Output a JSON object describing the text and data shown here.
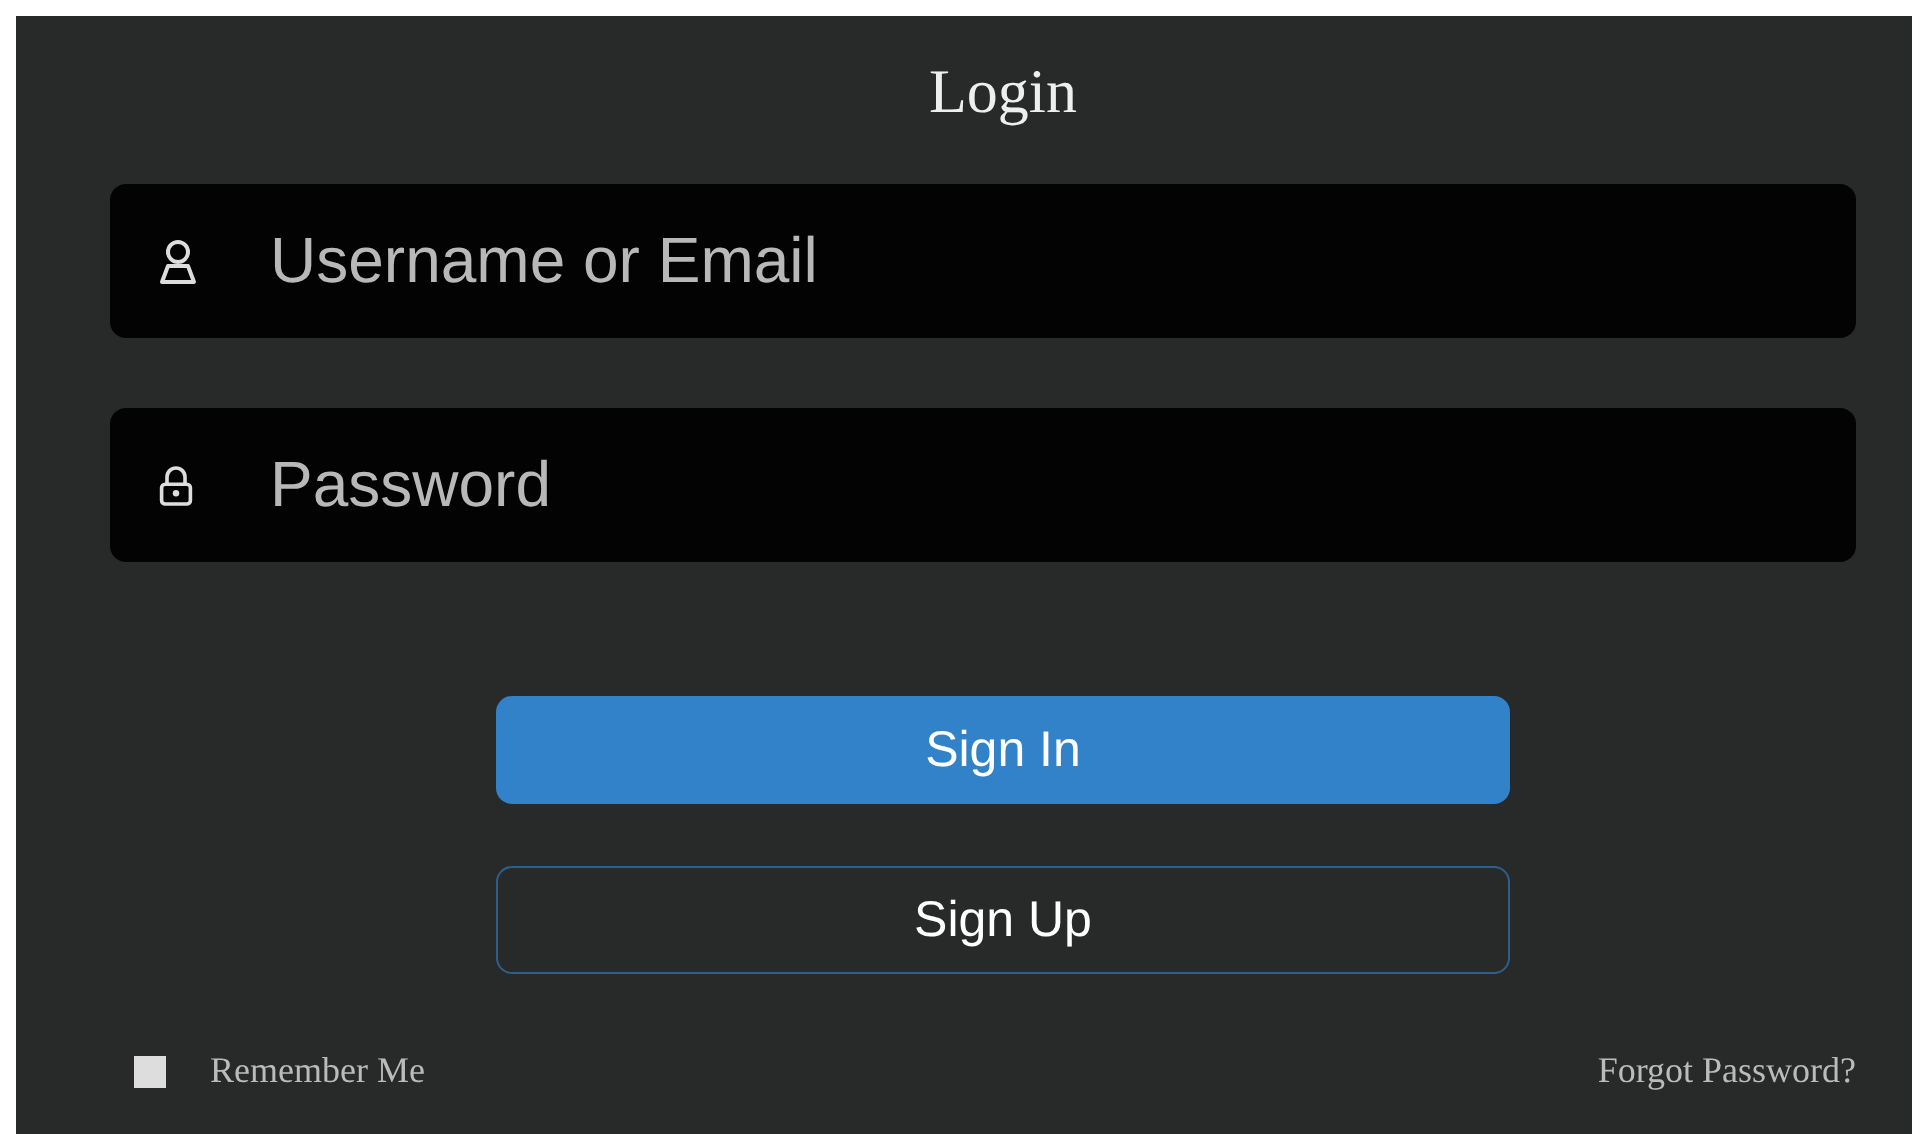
{
  "title": "Login",
  "fields": [
    {
      "kind": "user",
      "placeholder": "Username or Email"
    },
    {
      "kind": "password",
      "placeholder": "Password"
    }
  ],
  "buttons": [
    {
      "kind": "primary",
      "label": "Sign In"
    },
    {
      "kind": "secondary",
      "label": "Sign Up"
    }
  ],
  "remember": {
    "label": "Remember Me",
    "checked": false
  },
  "forgot_link": "Forgot Password?"
}
